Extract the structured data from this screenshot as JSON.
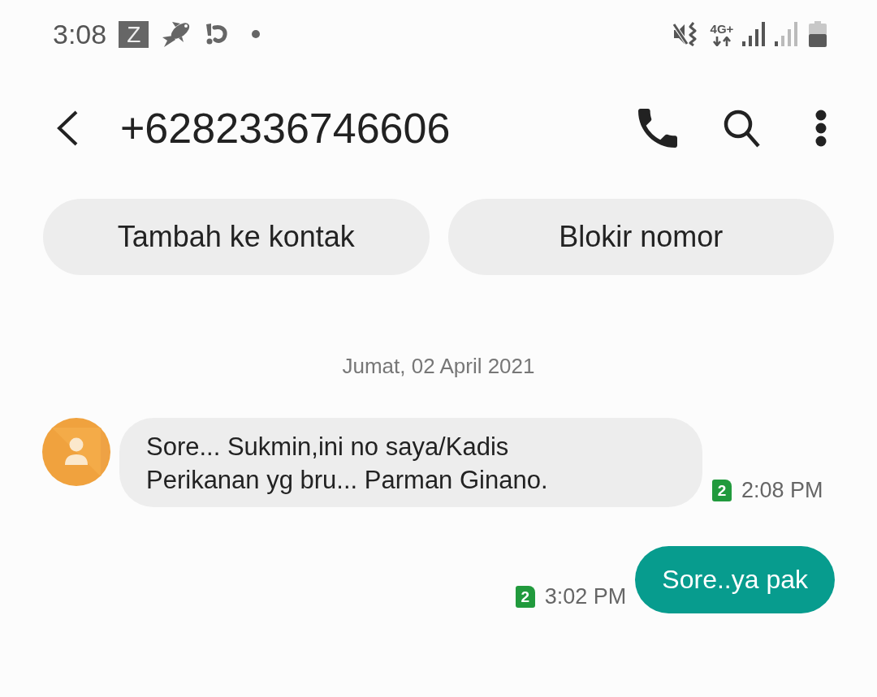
{
  "status_bar": {
    "time": "3:08",
    "app_badge": "Z",
    "network_type": "4G+"
  },
  "header": {
    "title": "+6282336746606"
  },
  "actions": [
    {
      "label": "Tambah ke kontak"
    },
    {
      "label": "Blokir nomor"
    }
  ],
  "conversation": {
    "date": "Jumat, 02 April 2021",
    "messages": [
      {
        "kind": "incoming",
        "text": "Sore... Sukmin,ini no saya/Kadis Perikanan yg bru... Parman Ginano.",
        "sim": "2",
        "time": "2:08 PM"
      },
      {
        "kind": "outgoing",
        "text": "Sore..ya pak",
        "sim": "2",
        "time": "3:02 PM"
      }
    ]
  }
}
